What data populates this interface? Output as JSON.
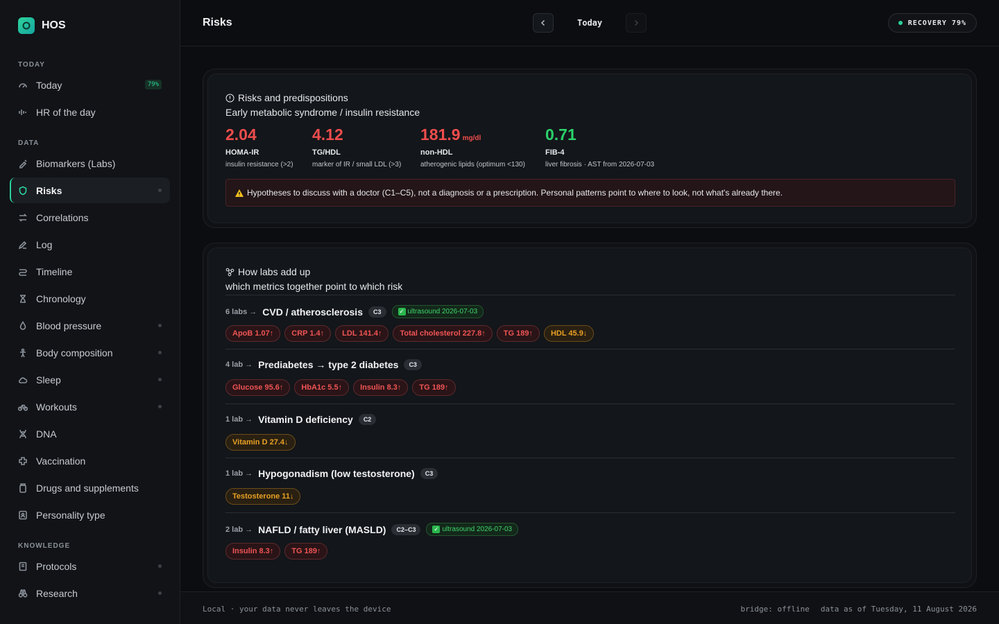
{
  "app": {
    "name": "HOS"
  },
  "sidebar": {
    "sections": {
      "today": "TODAY",
      "data": "DATA",
      "knowledge": "KNOWLEDGE"
    },
    "items": [
      {
        "label": "Today",
        "icon": "gauge-icon",
        "badge": "79%"
      },
      {
        "label": "HR of the day",
        "icon": "waveform-icon"
      },
      {
        "label": "Biomarkers (Labs)",
        "icon": "syringe-icon"
      },
      {
        "label": "Risks",
        "icon": "shield-icon"
      },
      {
        "label": "Correlations",
        "icon": "arrows-swap-icon"
      },
      {
        "label": "Log",
        "icon": "pencil-icon"
      },
      {
        "label": "Timeline",
        "icon": "route-icon"
      },
      {
        "label": "Chronology",
        "icon": "hourglass-icon"
      },
      {
        "label": "Blood pressure",
        "icon": "droplet-icon"
      },
      {
        "label": "Body composition",
        "icon": "body-icon"
      },
      {
        "label": "Sleep",
        "icon": "cloud-icon"
      },
      {
        "label": "Workouts",
        "icon": "bike-icon"
      },
      {
        "label": "DNA",
        "icon": "dna-icon"
      },
      {
        "label": "Vaccination",
        "icon": "cross-icon"
      },
      {
        "label": "Drugs and supplements",
        "icon": "pill-bottle-icon"
      },
      {
        "label": "Personality type",
        "icon": "id-card-icon"
      },
      {
        "label": "Protocols",
        "icon": "book-icon"
      },
      {
        "label": "Research",
        "icon": "binoculars-icon"
      }
    ]
  },
  "header": {
    "title": "Risks",
    "date_label": "Today",
    "recovery": "RECOVERY 79%"
  },
  "summary": {
    "title": "Risks and predispositions",
    "subtitle": "Early metabolic syndrome / insulin resistance",
    "metrics": [
      {
        "value": "2.04",
        "unit": "",
        "name": "HOMA-IR",
        "desc": "insulin resistance (>2)",
        "status": "bad"
      },
      {
        "value": "4.12",
        "unit": "",
        "name": "TG/HDL",
        "desc": "marker of IR / small LDL (>3)",
        "status": "bad"
      },
      {
        "value": "181.9",
        "unit": "mg/dl",
        "name": "non-HDL",
        "desc": "atherogenic lipids (optimum <130)",
        "status": "bad"
      },
      {
        "value": "0.71",
        "unit": "",
        "name": "FIB-4",
        "desc": "liver fibrosis · AST from 2026-07-03",
        "status": "good"
      }
    ],
    "disclaimer": "Hypotheses to discuss with a doctor (C1–C5), not a diagnosis or a prescription. Personal patterns point to where to look, not what's already there."
  },
  "labs": {
    "title": "How labs add up",
    "subtitle": "which metrics together point to which risk",
    "groups": [
      {
        "count": "6 labs →",
        "name": "CVD / atherosclerosis",
        "confidence": "C3",
        "ultrasound": "ultrasound 2026-07-03",
        "chips": [
          {
            "label": "ApoB 1.07↑",
            "tone": "red"
          },
          {
            "label": "CRP 1.4↑",
            "tone": "red"
          },
          {
            "label": "LDL 141.4↑",
            "tone": "red"
          },
          {
            "label": "Total cholesterol 227.8↑",
            "tone": "red"
          },
          {
            "label": "TG 189↑",
            "tone": "red"
          },
          {
            "label": "HDL 45.9↓",
            "tone": "amber"
          }
        ]
      },
      {
        "count": "4 lab →",
        "name": "Prediabetes → type 2 diabetes",
        "confidence": "C3",
        "ultrasound": "",
        "chips": [
          {
            "label": "Glucose 95.6↑",
            "tone": "red"
          },
          {
            "label": "HbA1c 5.5↑",
            "tone": "red"
          },
          {
            "label": "Insulin 8.3↑",
            "tone": "red"
          },
          {
            "label": "TG 189↑",
            "tone": "red"
          }
        ]
      },
      {
        "count": "1 lab →",
        "name": "Vitamin D deficiency",
        "confidence": "C2",
        "ultrasound": "",
        "chips": [
          {
            "label": "Vitamin D 27.4↓",
            "tone": "amber"
          }
        ]
      },
      {
        "count": "1 lab →",
        "name": "Hypogonadism (low testosterone)",
        "confidence": "C3",
        "ultrasound": "",
        "chips": [
          {
            "label": "Testosterone 11↓",
            "tone": "amber"
          }
        ]
      },
      {
        "count": "2 lab →",
        "name": "NAFLD / fatty liver (MASLD)",
        "confidence": "C2–C3",
        "ultrasound": "ultrasound 2026-07-03",
        "chips": [
          {
            "label": "Insulin 8.3↑",
            "tone": "red"
          },
          {
            "label": "TG 189↑",
            "tone": "red"
          }
        ]
      }
    ]
  },
  "footer": {
    "left": "Local · your data never leaves the device",
    "bridge": "bridge: offline",
    "data_as_of": "data as of Tuesday, 11 August 2026"
  },
  "colors": {
    "accent": "#2bd199",
    "danger": "#ef4d4d",
    "warning": "#e8a024",
    "good": "#2bd16b"
  }
}
